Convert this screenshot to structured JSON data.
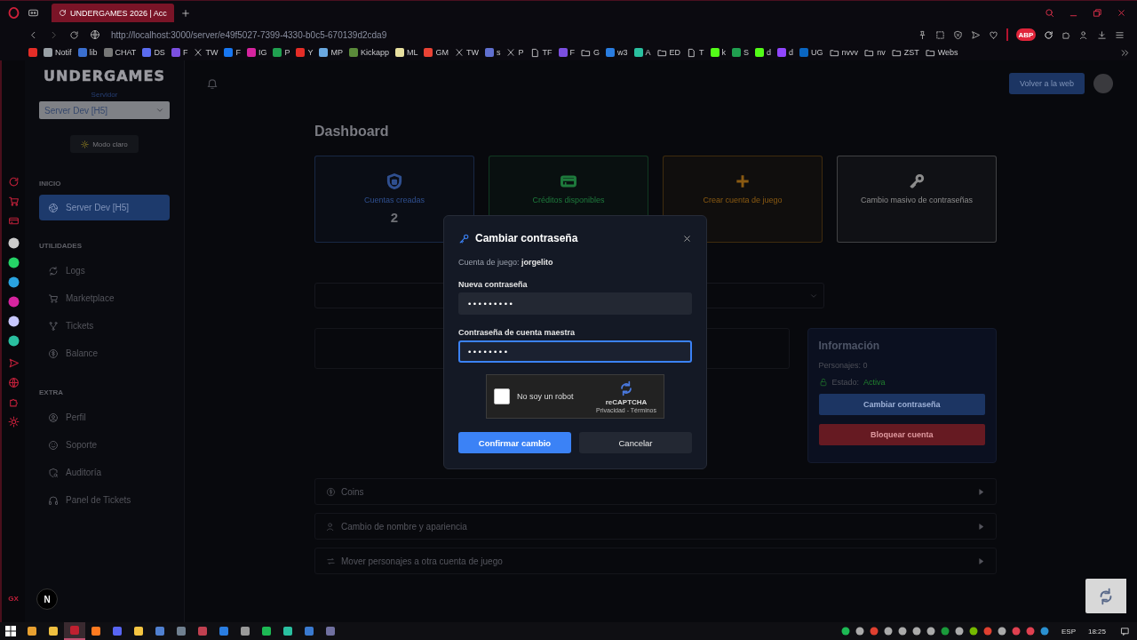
{
  "browser": {
    "tab_title": "UNDERGAMES 2026 | Acc",
    "url": "http://localhost:3000/server/e49f5027-7399-4330-b0c5-670139d2cda9",
    "extension_badge": "ABP",
    "bookmarks": [
      {
        "kind": "site",
        "color": "#e52d27"
      },
      {
        "label": "Notif",
        "kind": "site",
        "color": "#9aa0a6"
      },
      {
        "label": "lib",
        "kind": "site",
        "color": "#3b6fd0"
      },
      {
        "label": "CHAT",
        "kind": "site",
        "color": "#777777"
      },
      {
        "label": "DS",
        "kind": "site",
        "color": "#5b6cf0"
      },
      {
        "label": "F",
        "kind": "site",
        "color": "#7b4fe0"
      },
      {
        "label": "TW",
        "kind": "mark"
      },
      {
        "label": "F",
        "kind": "site",
        "color": "#1877f2"
      },
      {
        "label": "IG",
        "kind": "site",
        "color": "#d6249f"
      },
      {
        "label": "P",
        "kind": "site",
        "color": "#20a050"
      },
      {
        "label": "Y",
        "kind": "site",
        "color": "#e52d27"
      },
      {
        "label": "MP",
        "kind": "site",
        "color": "#6aa8e0"
      },
      {
        "label": "Kickapp",
        "kind": "site",
        "color": "#5a8a3a"
      },
      {
        "label": "ML",
        "kind": "site",
        "color": "#e8e0a0"
      },
      {
        "label": "GM",
        "kind": "site",
        "color": "#ea4335"
      },
      {
        "label": "TW",
        "kind": "mark"
      },
      {
        "label": "s",
        "kind": "site",
        "color": "#6070d0"
      },
      {
        "label": "P",
        "kind": "mark"
      },
      {
        "label": "TF",
        "kind": "page"
      },
      {
        "label": "F",
        "kind": "site",
        "color": "#7b4fe0"
      },
      {
        "label": "G",
        "kind": "folder"
      },
      {
        "label": "w3",
        "kind": "site",
        "color": "#2a7de1"
      },
      {
        "label": "A",
        "kind": "site",
        "color": "#2ac0a0"
      },
      {
        "label": "ED",
        "kind": "folder"
      },
      {
        "label": "T",
        "kind": "page"
      },
      {
        "label": "k",
        "kind": "site",
        "color": "#53fc18"
      },
      {
        "label": "S",
        "kind": "site",
        "color": "#20a050"
      },
      {
        "label": "d",
        "kind": "site",
        "color": "#53fc18"
      },
      {
        "label": "d",
        "kind": "site",
        "color": "#9146ff"
      },
      {
        "label": "UG",
        "kind": "site",
        "color": "#0a66c2"
      },
      {
        "label": "nvvv",
        "kind": "folder"
      },
      {
        "label": "nv",
        "kind": "folder"
      },
      {
        "label": "ZST",
        "kind": "folder"
      },
      {
        "label": "Webs",
        "kind": "folder"
      }
    ]
  },
  "rail": {
    "brand": "GX"
  },
  "sidebar": {
    "logo": "UNDERGAMES",
    "server_label": "Servidor",
    "server_select": "Server Dev [H5]",
    "theme_button": "Modo claro",
    "dev_badge": "N",
    "sections": [
      {
        "heading": "INICIO",
        "items": [
          {
            "label": "Server Dev [H5]",
            "selected": true
          }
        ]
      },
      {
        "heading": "UTILIDADES",
        "items": [
          {
            "label": "Logs",
            "selected": false
          },
          {
            "label": "Marketplace",
            "selected": false
          },
          {
            "label": "Tickets",
            "selected": false
          },
          {
            "label": "Balance",
            "selected": false
          }
        ]
      },
      {
        "heading": "EXTRA",
        "items": [
          {
            "label": "Perfil",
            "selected": false
          },
          {
            "label": "Soporte",
            "selected": false
          },
          {
            "label": "Auditoría",
            "selected": false
          },
          {
            "label": "Panel de Tickets",
            "selected": false
          }
        ]
      }
    ]
  },
  "header": {
    "back_button": "Volver a la web"
  },
  "dashboard": {
    "title": "Dashboard",
    "cards": [
      {
        "label": "Cuentas creadas",
        "value": "2",
        "color": "#2f4f8f"
      },
      {
        "label": "Créditos disponibles",
        "color": "#1e7a3c"
      },
      {
        "label": "Crear cuenta de juego",
        "color": "#8a5a12"
      },
      {
        "label": "Cambio masivo de contraseñas",
        "color": "#8c8c8c"
      }
    ]
  },
  "info": {
    "title": "Información",
    "characters": "Personajes: 0",
    "status_label": "Estado:",
    "status_value": "Activa",
    "buttons": [
      "Cambiar contraseña",
      "Bloquear cuenta"
    ]
  },
  "accordions": [
    {
      "label": "Coins"
    },
    {
      "label": "Cambio de nombre y apariencia"
    },
    {
      "label": "Mover personajes a otra cuenta de juego"
    }
  ],
  "modal": {
    "title": "Cambiar contraseña",
    "account_label": "Cuenta de juego:",
    "account_name": "jorgelito",
    "fields": [
      {
        "label": "Nueva contraseña",
        "value": "•••••••••",
        "focused": false
      },
      {
        "label": "Contraseña de cuenta maestra",
        "value": "••••••••",
        "focused": true
      }
    ],
    "captcha": {
      "label": "No soy un robot",
      "checked": false,
      "brand": "reCAPTCHA",
      "links": "Privacidad - Términos"
    },
    "confirm": "Confirmar cambio",
    "cancel": "Cancelar"
  },
  "taskbar": {
    "apps": [
      {
        "selected": false
      },
      {
        "selected": false
      },
      {
        "selected": true
      },
      {
        "selected": false
      },
      {
        "selected": false
      },
      {
        "selected": false
      },
      {
        "selected": false
      },
      {
        "selected": false
      },
      {
        "selected": false
      },
      {
        "selected": false
      },
      {
        "selected": false
      },
      {
        "selected": false
      },
      {
        "selected": false
      },
      {
        "selected": false
      },
      {
        "selected": false
      }
    ],
    "language": "ESP",
    "time": "18:25"
  }
}
